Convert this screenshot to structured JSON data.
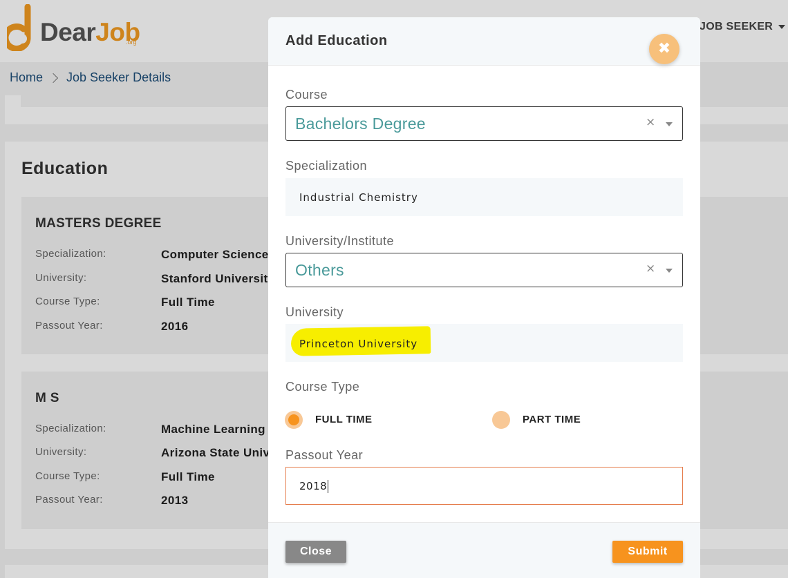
{
  "header": {
    "logo_text_prefix": "Dear",
    "logo_text_suffix": "Job",
    "logo_org": ".org",
    "user_menu_label": "JOB SEEKER",
    "brand_color": "#f39c22"
  },
  "breadcrumb": {
    "home": "Home",
    "current": "Job Seeker Details"
  },
  "education": {
    "section_title": "Education",
    "cards": [
      {
        "title": "MASTERS DEGREE",
        "rows": [
          {
            "label": "Specialization:",
            "value": "Computer Science"
          },
          {
            "label": "University:",
            "value": "Stanford University"
          },
          {
            "label": "Course Type:",
            "value": "Full Time"
          },
          {
            "label": "Passout Year:",
            "value": "2016"
          }
        ]
      },
      {
        "title": "M S",
        "rows": [
          {
            "label": "Specialization:",
            "value": "Machine Learning"
          },
          {
            "label": "University:",
            "value": "Arizona State University"
          },
          {
            "label": "Course Type:",
            "value": "Full Time"
          },
          {
            "label": "Passout Year:",
            "value": "2013"
          }
        ]
      }
    ]
  },
  "modal": {
    "title": "Add Education",
    "close_icon": "close-icon",
    "fields": {
      "course_label": "Course",
      "course_value": "Bachelors Degree",
      "specialization_label": "Specialization",
      "specialization_value": "Industrial Chemistry",
      "university_institute_label": "University/Institute",
      "university_institute_value": "Others",
      "university_label": "University",
      "university_value": "Princeton University",
      "course_type_label": "Course Type",
      "course_type_options": [
        "FULL TIME",
        "PART TIME"
      ],
      "course_type_selected": "FULL TIME",
      "passout_year_label": "Passout Year",
      "passout_year_value": "2018"
    },
    "buttons": {
      "close": "Close",
      "submit": "Submit"
    },
    "clear_glyph": "×",
    "accent_color": "#f7931e",
    "select_text_color": "#4a9a9a",
    "highlight_color": "#f7ee00"
  }
}
